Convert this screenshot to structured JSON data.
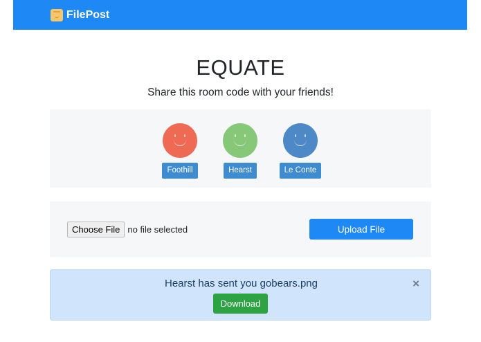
{
  "navbar": {
    "brand": "FilePost",
    "brand_icon": "file-post-logo-icon",
    "color": "#1e88f5"
  },
  "room": {
    "code": "EQUATE",
    "subtitle": "Share this room code with your friends!"
  },
  "members": [
    {
      "name": "Foothill",
      "color": "#ef6a55",
      "icon": "smiley-face-icon"
    },
    {
      "name": "Hearst",
      "color": "#86c878",
      "icon": "smiley-face-icon"
    },
    {
      "name": "Le Conte",
      "color": "#4d89c6",
      "icon": "smiley-face-icon"
    }
  ],
  "upload": {
    "choose_label": "Choose File",
    "file_status": "no file selected",
    "upload_label": "Upload File"
  },
  "alert": {
    "message": "Hearst has sent you gobears.png",
    "close": "×",
    "download_label": "Download"
  }
}
